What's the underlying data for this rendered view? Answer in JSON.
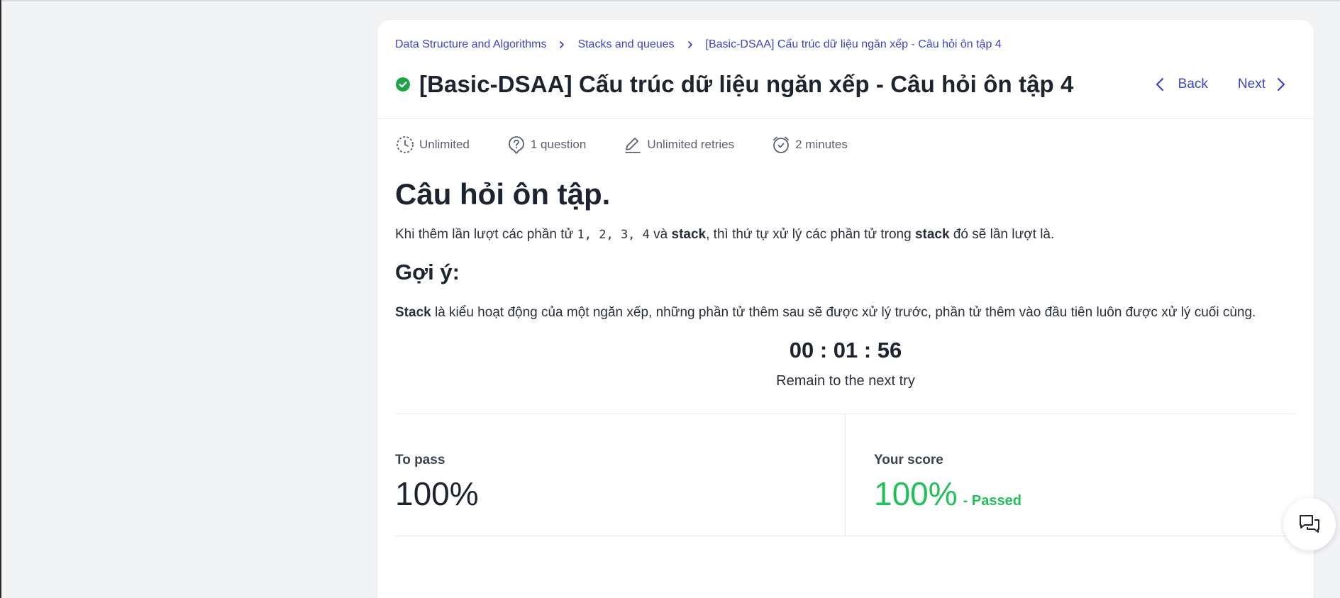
{
  "breadcrumb": {
    "items": [
      "Data Structure and Algorithms",
      "Stacks and queues",
      "[Basic-DSAA] Cấu trúc dữ liệu ngăn xếp - Câu hỏi ôn tập 4"
    ]
  },
  "header": {
    "title": "[Basic-DSAA] Cấu trúc dữ liệu ngăn xếp - Câu hỏi ôn tập 4",
    "back_label": "Back",
    "next_label": "Next",
    "status_icon": "check-circle-icon",
    "status_color": "#1ea446"
  },
  "meta": {
    "time_limit": "Unlimited",
    "questions": "1 question",
    "retries": "Unlimited retries",
    "duration": "2 minutes"
  },
  "content": {
    "heading": "Câu hỏi ôn tập.",
    "question_part1": "Khi thêm lần lượt các phần tử ",
    "question_code": "1, 2, 3, 4",
    "question_part2": " và ",
    "question_bold1": "stack",
    "question_part3": ", thì thứ tự xử lý các phần tử trong ",
    "question_bold2": "stack",
    "question_part4": " đó sẽ lần lượt là.",
    "hint_title": "Gợi ý:",
    "hint_bold": "Stack",
    "hint_text": " là kiểu hoạt động của một ngăn xếp, những phần tử thêm sau sẽ được xử lý trước, phần tử thêm vào đầu tiên luôn được xử lý cuối cùng."
  },
  "timer": {
    "value": "00 : 01 : 56",
    "label": "Remain to the next try"
  },
  "scores": {
    "to_pass_label": "To pass",
    "to_pass_value": "100%",
    "your_score_label": "Your score",
    "your_score_value": "100%",
    "status": "- Passed",
    "pass_color": "#22c05a"
  },
  "colors": {
    "accent": "#3b43c9",
    "background": "#f2f3f5"
  }
}
